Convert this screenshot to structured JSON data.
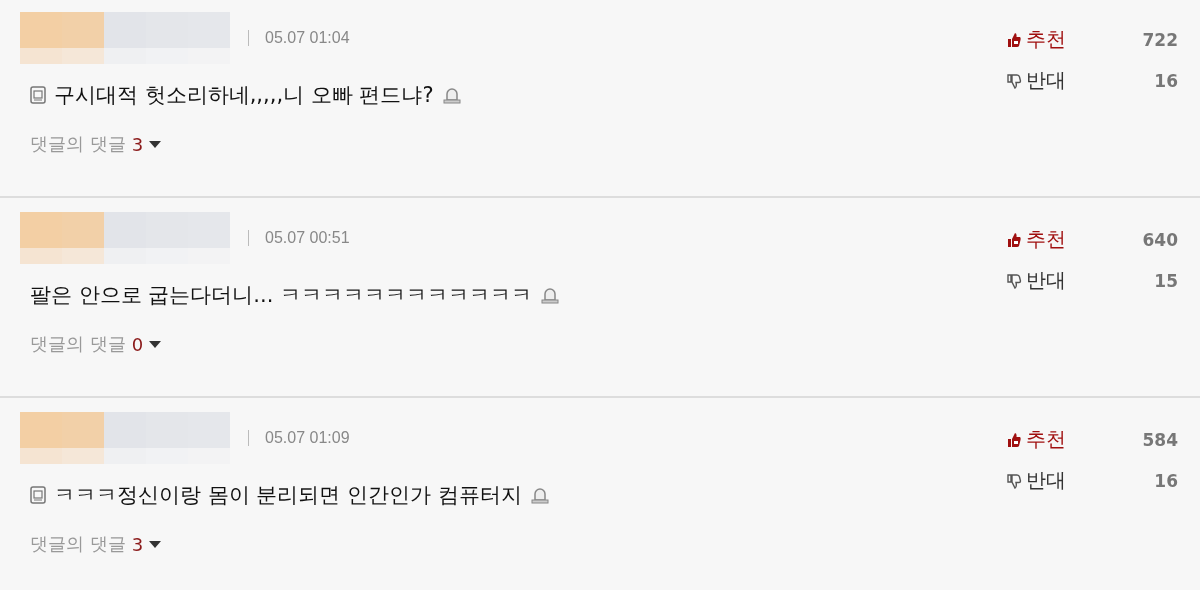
{
  "comments": [
    {
      "date": "05.07 01:04",
      "note_icon": true,
      "text": "구시대적 헛소리하네,,,,,니 오빠 편드냐?",
      "reply_label": "댓글의 댓글",
      "reply_count": "3",
      "up_label": "추천",
      "up_count": "722",
      "down_label": "반대",
      "down_count": "16"
    },
    {
      "date": "05.07 00:51",
      "note_icon": false,
      "text": "팔은 안으로 굽는다더니... ㅋㅋㅋㅋㅋㅋㅋㅋㅋㅋㅋㅋ",
      "reply_label": "댓글의 댓글",
      "reply_count": "0",
      "up_label": "추천",
      "up_count": "640",
      "down_label": "반대",
      "down_count": "15"
    },
    {
      "date": "05.07 01:09",
      "note_icon": true,
      "text": "ㅋㅋㅋ정신이랑 몸이 분리되면 인간인가 컴퓨터지",
      "reply_label": "댓글의 댓글",
      "reply_count": "3",
      "up_label": "추천",
      "up_count": "584",
      "down_label": "반대",
      "down_count": "16"
    }
  ]
}
